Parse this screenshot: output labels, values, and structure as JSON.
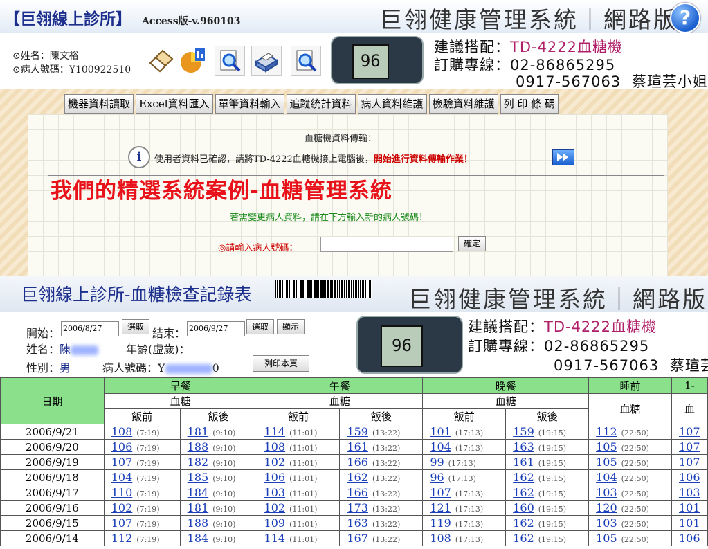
{
  "top": {
    "app_title": "【巨翎線上診所】",
    "app_version": "Access版-v.960103",
    "system_title": "巨翎健康管理系統｜網路版",
    "help_label": "?",
    "patient": {
      "name": "⊙姓名：陳文裕",
      "id": "⊙病人號碼：Y100922510"
    },
    "toolbar_icons": [
      "eraser-icon",
      "chart-icon",
      "preview-icon",
      "printer-icon",
      "search-icon"
    ],
    "meter_display": "96",
    "recommend_label": "建議搭配：",
    "recommend_value": "TD-4222血糖機",
    "order_label": "訂購專線：",
    "order_phone": "02-86865295",
    "mobile": "0917-567063",
    "contact": "蔡瑄芸小姐",
    "menu": [
      "機器資料讀取",
      "Excel資料匯入",
      "單筆資料輸入",
      "追蹤統計資料",
      "病人資料維護",
      "檢驗資料維護",
      "列 印 條 碼"
    ],
    "transfer_title": "血糖機資料傳輸：",
    "transfer_msg": "使用者資料已確認，請將TD-4222血糖機接上電腦後，",
    "transfer_highlight": "開始進行資料傳輸作業！",
    "promo": "我們的精選系統案例-血糖管理系統",
    "change_hint": "若需變更病人資料，請在下方輸入新的病人號碼！",
    "enter_label": "◎請輸入病人號碼：",
    "enter_value": "",
    "confirm_label": "確定"
  },
  "bottom": {
    "report_title": "巨翎線上診所-血糖檢查記錄表",
    "system_title": "巨翎健康管理系統｜網路版",
    "start_label": "開始：",
    "start_value": "2006/8/27",
    "select_label": "選取",
    "end_label": "結束：",
    "end_value": "2006/9/27",
    "show_label": "顯示",
    "name_label": "姓名：",
    "name_visible": "陳",
    "age_label": "年齡(虛歲)：",
    "sex_label": "性別：",
    "sex_value": "男",
    "pid_label": "病人號碼：",
    "pid_prefix": "Y",
    "pid_suffix": "0",
    "print_label": "列印本頁",
    "meter_display": "96",
    "recommend_label": "建議搭配：",
    "recommend_value": "TD-4222血糖機",
    "order_label": "訂購專線：",
    "order_phone": "02-86865295",
    "mobile": "0917-567063",
    "contact": "蔡瑄芸"
  },
  "table": {
    "date_header": "日期",
    "meals": [
      "早餐",
      "午餐",
      "晚餐",
      "睡前",
      "1-"
    ],
    "glucose": "血糖",
    "before": "飯前",
    "after": "飯後",
    "last_glucose_partial": "血",
    "rows": [
      {
        "date": "2006/9/21",
        "cells": [
          [
            "108",
            "(7:19)"
          ],
          [
            "181",
            "(9:10)"
          ],
          [
            "114",
            "(11:01)"
          ],
          [
            "159",
            "(13:22)"
          ],
          [
            "101",
            "(17:13)"
          ],
          [
            "159",
            "(19:15)"
          ],
          [
            "112",
            "(22:50)"
          ],
          [
            "107",
            ""
          ]
        ]
      },
      {
        "date": "2006/9/20",
        "cells": [
          [
            "106",
            "(7:19)"
          ],
          [
            "188",
            "(9:10)"
          ],
          [
            "108",
            "(11:01)"
          ],
          [
            "161",
            "(13:22)"
          ],
          [
            "104",
            "(17:13)"
          ],
          [
            "163",
            "(19:15)"
          ],
          [
            "105",
            "(22:50)"
          ],
          [
            "107",
            ""
          ]
        ]
      },
      {
        "date": "2006/9/19",
        "cells": [
          [
            "107",
            "(7:19)"
          ],
          [
            "182",
            "(9:10)"
          ],
          [
            "102",
            "(11:01)"
          ],
          [
            "166",
            "(13:22)"
          ],
          [
            "99",
            "(17:13)"
          ],
          [
            "161",
            "(19:15)"
          ],
          [
            "105",
            "(22:50)"
          ],
          [
            "107",
            ""
          ]
        ]
      },
      {
        "date": "2006/9/18",
        "cells": [
          [
            "104",
            "(7:19)"
          ],
          [
            "185",
            "(9:10)"
          ],
          [
            "106",
            "(11:01)"
          ],
          [
            "162",
            "(13:22)"
          ],
          [
            "96",
            "(17:13)"
          ],
          [
            "162",
            "(19:15)"
          ],
          [
            "104",
            "(22:50)"
          ],
          [
            "106",
            ""
          ]
        ]
      },
      {
        "date": "2006/9/17",
        "cells": [
          [
            "110",
            "(7:19)"
          ],
          [
            "184",
            "(9:10)"
          ],
          [
            "103",
            "(11:01)"
          ],
          [
            "166",
            "(13:22)"
          ],
          [
            "107",
            "(17:13)"
          ],
          [
            "162",
            "(19:15)"
          ],
          [
            "103",
            "(22:50)"
          ],
          [
            "103",
            ""
          ]
        ]
      },
      {
        "date": "2006/9/16",
        "cells": [
          [
            "102",
            "(7:19)"
          ],
          [
            "181",
            "(9:10)"
          ],
          [
            "102",
            "(11:01)"
          ],
          [
            "173",
            "(13:22)"
          ],
          [
            "121",
            "(17:13)"
          ],
          [
            "160",
            "(19:15)"
          ],
          [
            "120",
            "(22:50)"
          ],
          [
            "101",
            ""
          ]
        ]
      },
      {
        "date": "2006/9/15",
        "cells": [
          [
            "107",
            "(7:19)"
          ],
          [
            "188",
            "(9:10)"
          ],
          [
            "109",
            "(11:01)"
          ],
          [
            "163",
            "(13:22)"
          ],
          [
            "119",
            "(17:13)"
          ],
          [
            "162",
            "(19:15)"
          ],
          [
            "103",
            "(22:50)"
          ],
          [
            "101",
            ""
          ]
        ]
      },
      {
        "date": "2006/9/14",
        "cells": [
          [
            "112",
            "(7:19)"
          ],
          [
            "184",
            "(9:10)"
          ],
          [
            "114",
            "(11:01)"
          ],
          [
            "167",
            "(13:22)"
          ],
          [
            "108",
            "(17:13)"
          ],
          [
            "162",
            "(19:15)"
          ],
          [
            "105",
            "(22:50)"
          ],
          [
            "106",
            ""
          ]
        ]
      }
    ]
  },
  "colors": {
    "title_blue": "#1d2f8c",
    "promo_red": "#e8121a",
    "meal_green": "#8be08b",
    "value_blue": "#1a3fb8",
    "magenta": "#b0206a"
  }
}
